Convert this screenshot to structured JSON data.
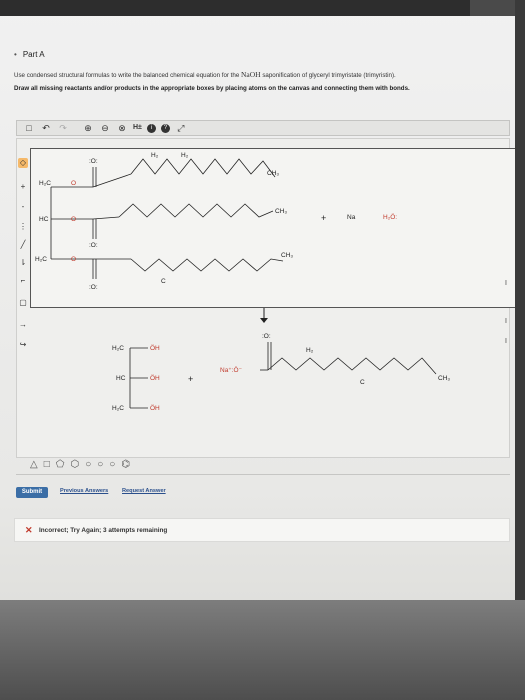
{
  "header": {
    "part_label": "Part A",
    "instruction_prefix": "Use condensed structural formulas to write the balanced chemical equation for the",
    "instruction_reagent": "NaOH",
    "instruction_suffix": "saponification of glyceryl trimyristate (trimyristin).",
    "instruction_line2": "Draw all missing reactants and/or products in the appropriate boxes by placing atoms on the canvas and connecting them with bonds."
  },
  "toolbar": {
    "tools": [
      "new-icon",
      "undo-icon",
      "redo-icon",
      "zoom-in-icon",
      "zoom-out-icon",
      "zoom-fit-icon",
      "H±",
      "info-icon",
      "help-icon",
      "fullscreen-icon"
    ],
    "hydrogen_label": "H±",
    "help_label": "?"
  },
  "left_tools": [
    "select-icon",
    "bond-icon",
    "dash-bond-icon",
    "wedge-bond-icon",
    "text-tool-icon",
    "arrow-icon",
    "charge-icon",
    "box-icon",
    "eraser-icon",
    "curved-arrow-icon"
  ],
  "reaction": {
    "reactant_box": {
      "labels": {
        "o_top": ":O:",
        "o_mid": ":O:",
        "o_bot": ":O:",
        "h2c_top": "H₂C",
        "hc": "HC",
        "h2c_bot": "H₂C",
        "ester_o1": "O",
        "ester_o2": "O",
        "ester_o3": "O",
        "ch3_a": "CH₃",
        "ch3_b": "CH₃",
        "ch3_c": "CH₃",
        "ch2_1": "H₂",
        "ch2_2": "H₂",
        "c": "C"
      },
      "plus": "+",
      "na": "Na",
      "water": "H₂Ö:"
    },
    "product_box": {
      "glycerol": {
        "row1_left": "H₂C",
        "row1_right": "ÖH",
        "row2_left": "HC",
        "row2_right": "ÖH",
        "row3_left": "H₂C",
        "row3_right": "ÖH"
      },
      "plus": "+",
      "soap_na": "Na⁺:Ö⁻",
      "soap_o_top": ":O:",
      "soap_ch3": "CH₃",
      "soap_h2": "H₂",
      "soap_c": "C"
    }
  },
  "shapes_bar": [
    "triangle-icon",
    "square-icon",
    "pentagon-icon",
    "hexagon-icon",
    "heptagon-icon",
    "octagon-icon",
    "circle-icon",
    "benzene-icon"
  ],
  "actions": {
    "submit": "Submit",
    "previous_answers": "Previous Answers",
    "request_answer": "Request Answer"
  },
  "feedback": {
    "icon": "x-icon",
    "message": "Incorrect; Try Again; 3 attempts remaining"
  },
  "side_marks": [
    "I",
    "I",
    "I"
  ]
}
